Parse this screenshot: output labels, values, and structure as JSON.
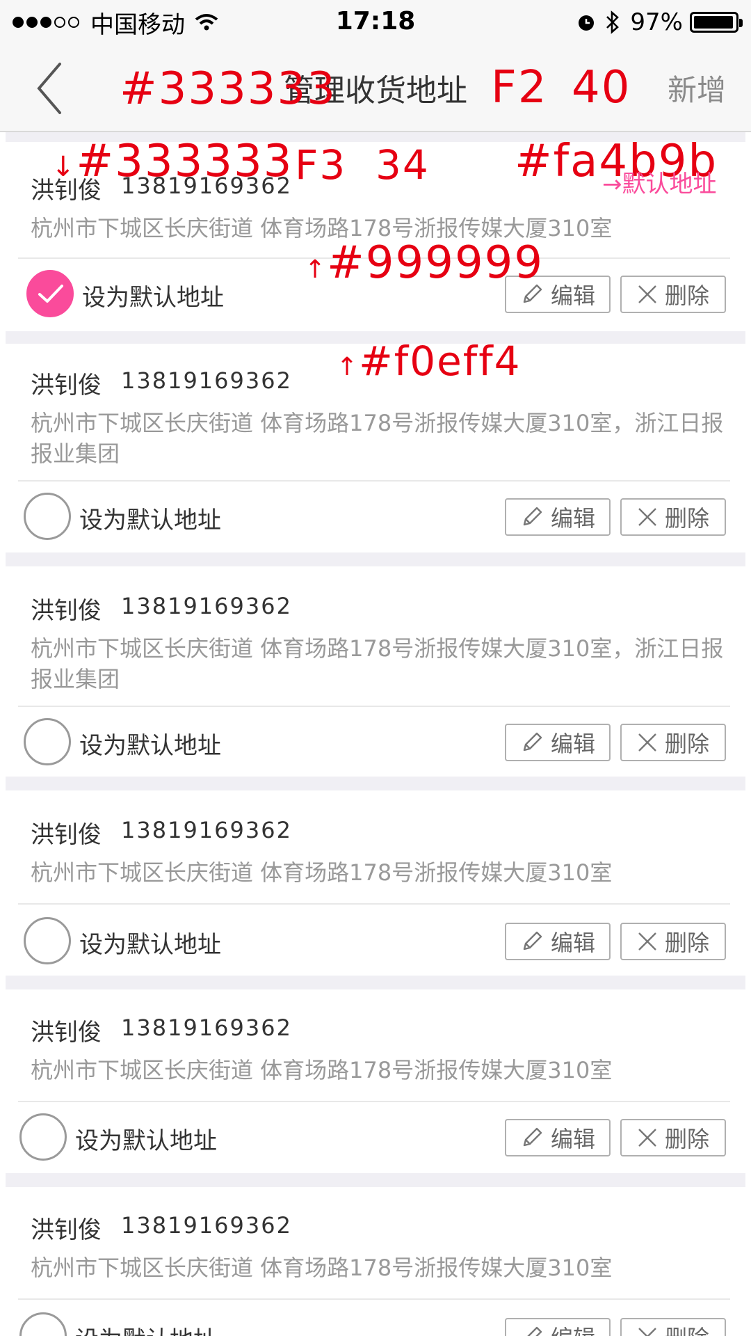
{
  "statusbar": {
    "carrier": "中国移动",
    "time": "17:18",
    "battery": "97%",
    "battery_level": 0.97
  },
  "nav": {
    "title": "管理收货地址",
    "add_label": "新增"
  },
  "annotations": {
    "title_color": "#333333",
    "title_font": "F2",
    "title_size": "40",
    "name_color": "#333333",
    "name_font": "F3",
    "name_size": "34",
    "default_color": "#fa4b9b",
    "default_arrow": "→默认地址",
    "addr_color": "#999999",
    "bg_color": "#f0eff4"
  },
  "colors": {
    "accent": "#fa4b9b",
    "text": "#333333",
    "secondary": "#999999",
    "separator": "#f0eff4"
  },
  "set_default_label": "设为默认地址",
  "edit_label": "编辑",
  "delete_label": "删除",
  "addresses": [
    {
      "name": "洪钊俊",
      "phone": "13819169362",
      "address": "杭州市下城区长庆街道 体育场路178号浙报传媒大厦310室",
      "is_default": true
    },
    {
      "name": "洪钊俊",
      "phone": "13819169362",
      "address": "杭州市下城区长庆街道 体育场路178号浙报传媒大厦310室，浙江日报报业集团",
      "is_default": false
    },
    {
      "name": "洪钊俊",
      "phone": "13819169362",
      "address": "杭州市下城区长庆街道 体育场路178号浙报传媒大厦310室，浙江日报报业集团",
      "is_default": false
    },
    {
      "name": "洪钊俊",
      "phone": "13819169362",
      "address": "杭州市下城区长庆街道 体育场路178号浙报传媒大厦310室",
      "is_default": false
    },
    {
      "name": "洪钊俊",
      "phone": "13819169362",
      "address": "杭州市下城区长庆街道 体育场路178号浙报传媒大厦310室",
      "is_default": false
    },
    {
      "name": "洪钊俊",
      "phone": "13819169362",
      "address": "杭州市下城区长庆街道 体育场路178号浙报传媒大厦310室",
      "is_default": false
    }
  ]
}
